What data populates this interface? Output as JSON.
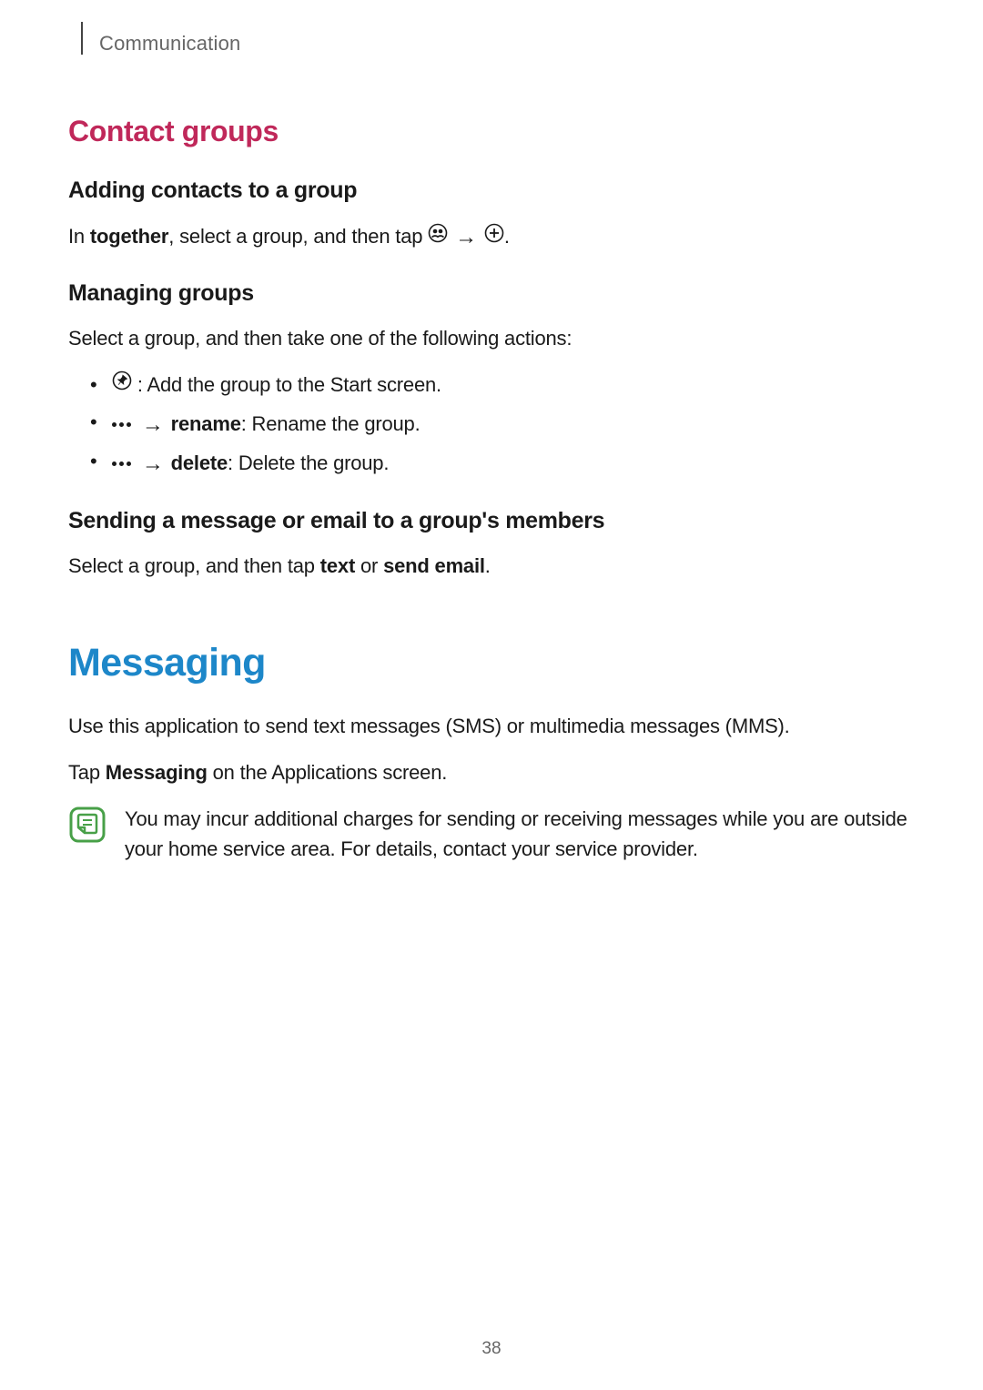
{
  "header": {
    "section": "Communication"
  },
  "sections": {
    "contact_groups": {
      "title": "Contact groups",
      "adding": {
        "title": "Adding contacts to a group",
        "text_prefix": "In ",
        "text_bold1": "together",
        "text_mid": ", select a group, and then tap ",
        "text_end": "."
      },
      "managing": {
        "title": "Managing groups",
        "intro": "Select a group, and then take one of the following actions:",
        "item1_text": " : Add the group to the Start screen.",
        "item2_label": "rename",
        "item2_text": ": Rename the group.",
        "item3_label": "delete",
        "item3_text": ": Delete the group."
      },
      "sending": {
        "title": "Sending a message or email to a group's members",
        "text_prefix": "Select a group, and then tap ",
        "text_bold1": "text",
        "text_mid": " or ",
        "text_bold2": "send email",
        "text_end": "."
      }
    },
    "messaging": {
      "title": "Messaging",
      "intro": "Use this application to send text messages (SMS) or multimedia messages (MMS).",
      "tap_prefix": "Tap ",
      "tap_bold": "Messaging",
      "tap_suffix": " on the Applications screen.",
      "note": "You may incur additional charges for sending or receiving messages while you are outside your home service area. For details, contact your service provider."
    }
  },
  "page_number": "38"
}
